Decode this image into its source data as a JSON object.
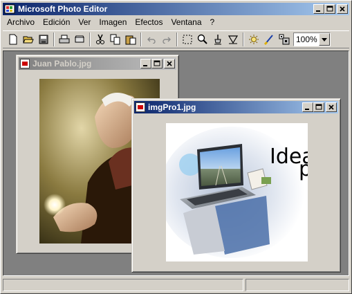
{
  "window": {
    "title": "Microsoft Photo Editor"
  },
  "menu": [
    "Archivo",
    "Edición",
    "Ver",
    "Imagen",
    "Efectos",
    "Ventana",
    "?"
  ],
  "toolbar": {
    "buttons": [
      "new-icon",
      "open-icon",
      "save-icon",
      "print-icon",
      "scan-icon",
      "cut-icon",
      "copy-icon",
      "paste-icon",
      "undo-icon",
      "redo-icon",
      "select-icon",
      "zoom-icon",
      "smudge-icon",
      "transparent-icon",
      "effect-icon",
      "balance-icon",
      "resample-icon"
    ],
    "zoom_value": "100%"
  },
  "documents": [
    {
      "title": "Juan Pablo.jpg",
      "state": "inactive"
    },
    {
      "title": "imgPro1.jpg",
      "state": "active",
      "image_text": [
        "Idea",
        "p"
      ]
    }
  ],
  "colors": {
    "titlebar_active": "#0a246a",
    "titlebar_inactive": "#808080",
    "workspace": "#808080",
    "chrome": "#d4d0c8"
  }
}
